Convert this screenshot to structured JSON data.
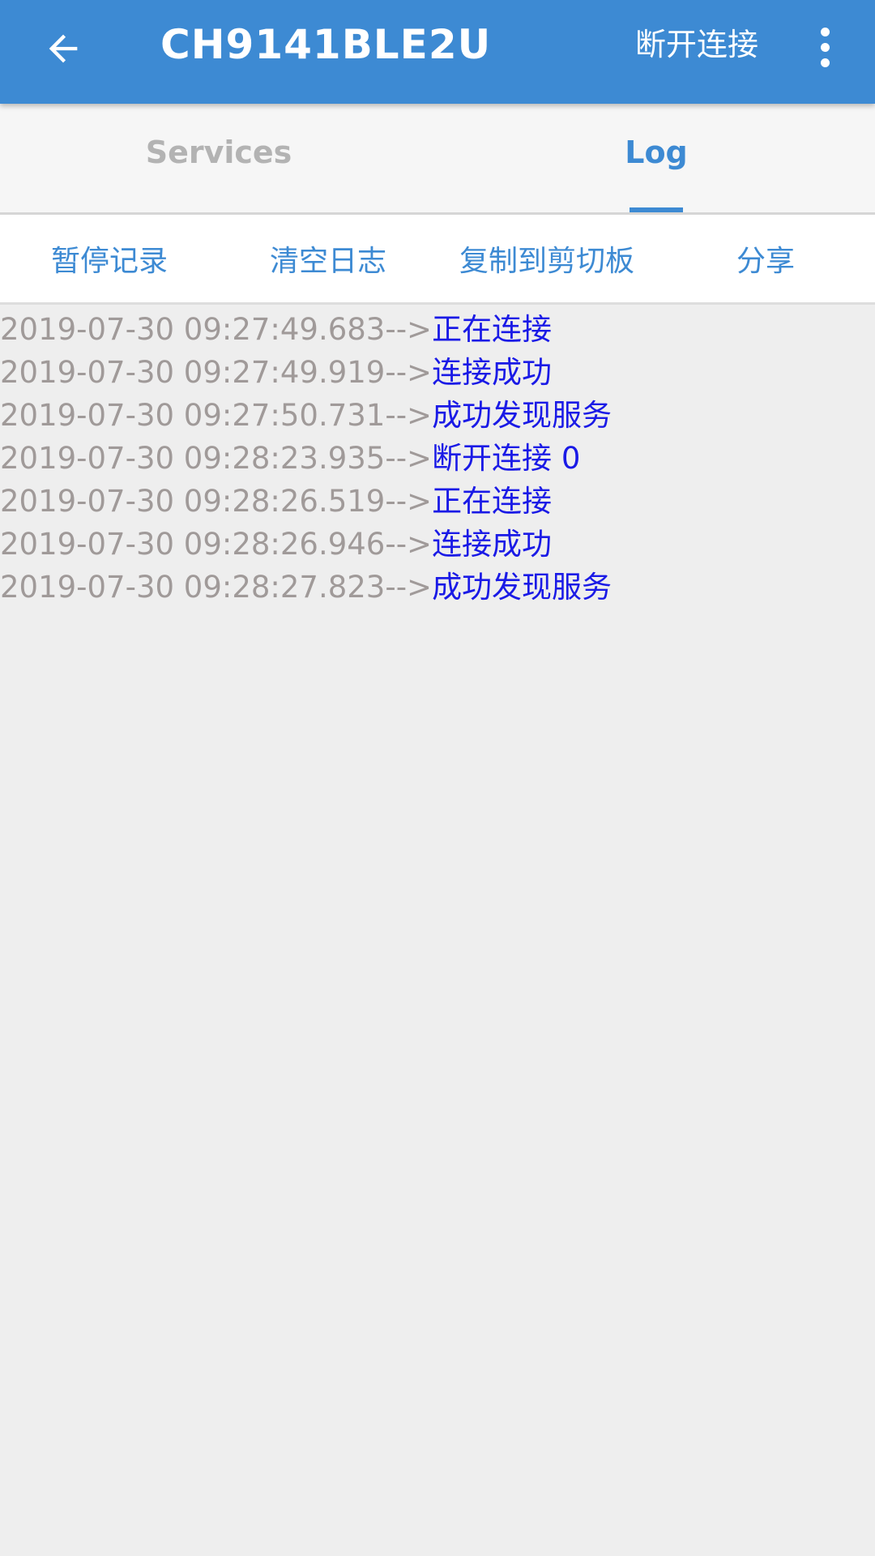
{
  "appbar": {
    "title": "CH9141BLE2U",
    "disconnect_label": "断开连接"
  },
  "tabs": [
    {
      "label": "Services",
      "active": false
    },
    {
      "label": "Log",
      "active": true
    }
  ],
  "actions": {
    "pause": "暂停记录",
    "clear": "清空日志",
    "copy": "复制到剪切板",
    "share": "分享"
  },
  "log": [
    {
      "time": "2019-07-30 09:27:49.683-->",
      "msg": "正在连接"
    },
    {
      "time": "2019-07-30 09:27:49.919-->",
      "msg": "连接成功"
    },
    {
      "time": "2019-07-30 09:27:50.731-->",
      "msg": "成功发现服务"
    },
    {
      "time": "2019-07-30 09:28:23.935-->",
      "msg": "断开连接 0"
    },
    {
      "time": "2019-07-30 09:28:26.519-->",
      "msg": "正在连接"
    },
    {
      "time": "2019-07-30 09:28:26.946-->",
      "msg": "连接成功"
    },
    {
      "time": "2019-07-30 09:28:27.823-->",
      "msg": "成功发现服务"
    }
  ],
  "colors": {
    "accent": "#3d8ad3",
    "timestamp": "#a09a99",
    "message": "#1a1ae6",
    "background": "#eeeeee"
  },
  "icons": {
    "back": "arrow-left-icon",
    "more": "more-vertical-icon"
  }
}
